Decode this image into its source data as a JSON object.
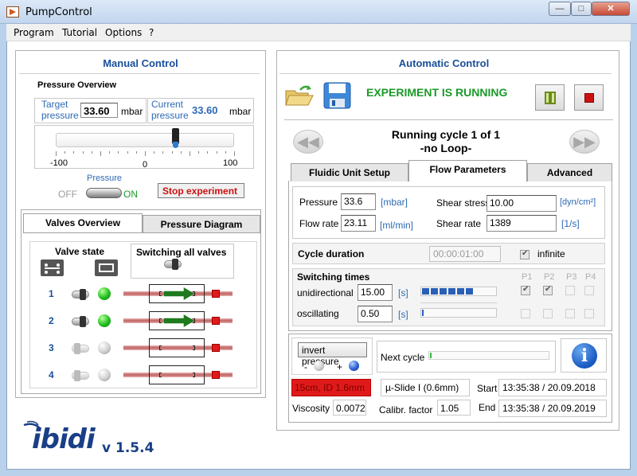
{
  "window": {
    "title": "PumpControl",
    "min": "—",
    "max": "□",
    "close": "✕"
  },
  "menu": [
    "Program",
    "Tutorial",
    "Options",
    "?"
  ],
  "manual": {
    "title": "Manual Control",
    "pressure_overview": "Pressure Overview",
    "target_label_1": "Target",
    "target_label_2": "pressure",
    "target_value": "33.60",
    "target_unit": "mbar",
    "current_label_1": "Current",
    "current_label_2": "pressure",
    "current_value": "33.60",
    "current_unit": "mbar",
    "slider_min": "-100",
    "slider_mid": "0",
    "slider_max": "100",
    "slider_level_pct": 33.6,
    "pressure_label": "Pressure",
    "off": "OFF",
    "on": "ON",
    "stop_button": "Stop experiment",
    "tabs": [
      "Valves Overview",
      "Pressure Diagram"
    ],
    "valve_state": "Valve state",
    "switching_all": "Switching all valves",
    "valves": [
      {
        "num": "1",
        "open": true
      },
      {
        "num": "2",
        "open": true
      },
      {
        "num": "3",
        "open": false
      },
      {
        "num": "4",
        "open": false
      }
    ]
  },
  "auto": {
    "title": "Automatic Control",
    "status": "EXPERIMENT IS RUNNING",
    "cycle_line1": "Running cycle 1 of 1",
    "cycle_line2": "-no Loop-",
    "tabs": [
      "Fluidic Unit Setup",
      "Flow Parameters",
      "Advanced"
    ],
    "pressure_label": "Pressure",
    "pressure_value": "33.6",
    "pressure_unit": "[mbar]",
    "flowrate_label": "Flow rate",
    "flowrate_value": "23.11",
    "flowrate_unit": "[ml/min]",
    "shear_stress_label": "Shear stress",
    "shear_stress_value": "10.00",
    "shear_stress_unit": "[dyn/cm²]",
    "shear_rate_label": "Shear rate",
    "shear_rate_value": "1389",
    "shear_rate_unit": "[1/s]",
    "cycle_duration_label": "Cycle duration",
    "cycle_duration_value": "00:00:01:00",
    "infinite_label": "infinite",
    "switching_times_label": "Switching times",
    "unidirectional_label": "unidirectional",
    "unidirectional_value": "15.00",
    "unidirectional_unit": "[s]",
    "oscillating_label": "oscillating",
    "oscillating_value": "0.50",
    "oscillating_unit": "[s]",
    "p_headers": [
      "P1",
      "P2",
      "P3",
      "P4"
    ],
    "invert_pressure": "invert pressure",
    "minus": "-",
    "plus": "+",
    "next_cycle": "Next cycle",
    "tube_setup": "15cm, ID 1.6mm",
    "slide": "µ-Slide I (0.6mm)",
    "start_label": "Start",
    "start_value": "13:35:38 / 20.09.2018",
    "end_label": "End",
    "end_value": "13:35:38 / 20.09.2019",
    "viscosity_label": "Viscosity",
    "viscosity_value": "0.0072",
    "calibr_label": "Calibr. factor",
    "calibr_value": "1.05"
  },
  "brand": {
    "logo": "ibidi",
    "version": "v 1.5.4"
  },
  "colors": {
    "title_blue": "#1a4f9a",
    "running_green": "#1b9a2a",
    "stop_red": "#cc1010",
    "tube_red": "#e01a1a"
  }
}
